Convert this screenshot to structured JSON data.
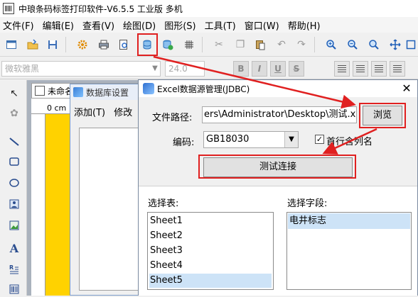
{
  "window": {
    "title": "中琅条码标签打印软件-V6.5.5 工业版 多机"
  },
  "menu": {
    "items": [
      "文件(F)",
      "编辑(E)",
      "查看(V)",
      "绘图(D)",
      "图形(S)",
      "工具(T)",
      "窗口(W)",
      "帮助(H)"
    ]
  },
  "format_bar": {
    "font": "微软雅黑",
    "size": "24.0",
    "bold": "B",
    "italic": "I",
    "underline": "U",
    "strike": "S"
  },
  "document": {
    "tab_label": "未命名",
    "ruler_unit": "0 cm"
  },
  "db_dialog": {
    "title": "数据库设置",
    "menu_add": "添加(T)",
    "menu_modify": "修改"
  },
  "excel_dialog": {
    "title": "Excel数据源管理(JDBC)",
    "close": "✕",
    "path_label": "文件路径:",
    "path_value": "ers\\Administrator\\Desktop\\测试.xls",
    "browse_label": "浏览",
    "encoding_label": "编码:",
    "encoding_value": "GB18030",
    "first_row_label": "首行含列名",
    "first_row_checked": true,
    "test_label": "测试连接",
    "tables_label": "选择表:",
    "fields_label": "选择字段:",
    "tables": [
      "Sheet1",
      "Sheet2",
      "Sheet3",
      "Sheet4",
      "Sheet5"
    ],
    "selected_table": "Sheet5",
    "fields": [
      "电井标志"
    ]
  },
  "colors": {
    "highlight_red": "#e02020",
    "selection_blue": "#cde3f7",
    "canvas_yellow": "#ffd200"
  },
  "icons": {
    "toolbar": [
      "new-icon",
      "open-icon",
      "save-icon",
      "settings-icon",
      "print-icon",
      "print-preview-icon",
      "database-icon",
      "database-add-icon",
      "grid-icon",
      "cut-icon",
      "copy-icon",
      "paste-icon",
      "undo-icon",
      "redo-icon",
      "zoom-in-icon",
      "zoom-out-icon",
      "zoom-fit-icon",
      "fit-page-icon",
      "fullscreen-icon"
    ],
    "left_tools": [
      "pointer-icon",
      "rotate-icon",
      "line-icon",
      "rectangle-icon",
      "ellipse-icon",
      "image-icon",
      "picture-icon",
      "text-icon",
      "multiline-text-icon",
      "barcode-icon"
    ]
  }
}
